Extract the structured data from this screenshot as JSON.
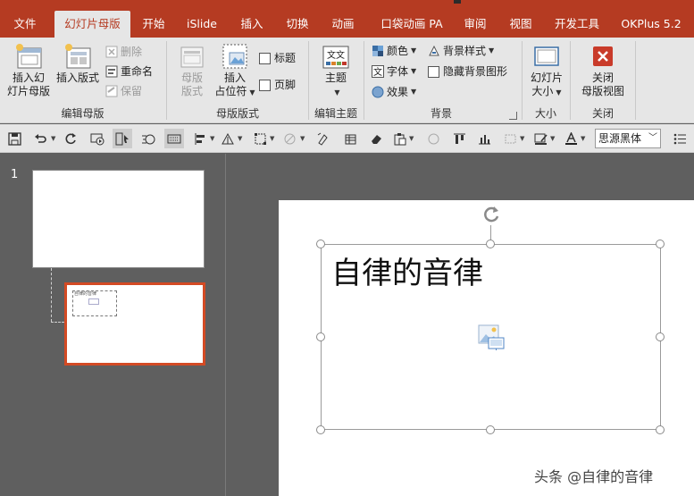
{
  "tabs": [
    {
      "label": "文件",
      "active": false
    },
    {
      "label": "幻灯片母版",
      "active": true
    },
    {
      "label": "开始",
      "active": false
    },
    {
      "label": "iSlide",
      "active": false
    },
    {
      "label": "插入",
      "active": false
    },
    {
      "label": "切换",
      "active": false
    },
    {
      "label": "动画",
      "active": false
    },
    {
      "label": "口袋动画 PA",
      "active": false
    },
    {
      "label": "审阅",
      "active": false
    },
    {
      "label": "视图",
      "active": false
    },
    {
      "label": "开发工具",
      "active": false
    },
    {
      "label": "OKPlus 5.2",
      "active": false
    }
  ],
  "ribbon": {
    "edit_master": {
      "label": "编辑母版",
      "insert_master_l1": "插入幻",
      "insert_master_l2": "灯片母版",
      "insert_layout": "插入版式",
      "delete": "删除",
      "rename": "重命名",
      "preserve": "保留"
    },
    "master_layout": {
      "label": "母版版式",
      "master_layout_l1": "母版",
      "master_layout_l2": "版式",
      "insert_placeholder_l1": "插入",
      "insert_placeholder_l2": "占位符",
      "title": "标题",
      "footer": "页脚"
    },
    "edit_theme": {
      "label": "编辑主题",
      "themes": "主题"
    },
    "background": {
      "label": "背景",
      "colors": "颜色",
      "fonts": "字体",
      "effects": "效果",
      "bg_styles": "背景样式",
      "hide_bg": "隐藏背景图形"
    },
    "size": {
      "label": "大小",
      "slide_size_l1": "幻灯片",
      "slide_size_l2": "大小"
    },
    "close": {
      "label": "关闭",
      "close_view_l1": "关闭",
      "close_view_l2": "母版视图"
    }
  },
  "qat": {
    "font_name": "思源黑体"
  },
  "slides": {
    "number": "1"
  },
  "slide": {
    "title": "自律的音律",
    "mini_title": "自律的音律"
  },
  "watermark": "头条 @自律的音律",
  "colors": {
    "accent": "#b53b22",
    "selected_border": "#d34a24",
    "ribbon_bg": "#e6e6e6",
    "workspace_bg": "#5f5f5f"
  }
}
